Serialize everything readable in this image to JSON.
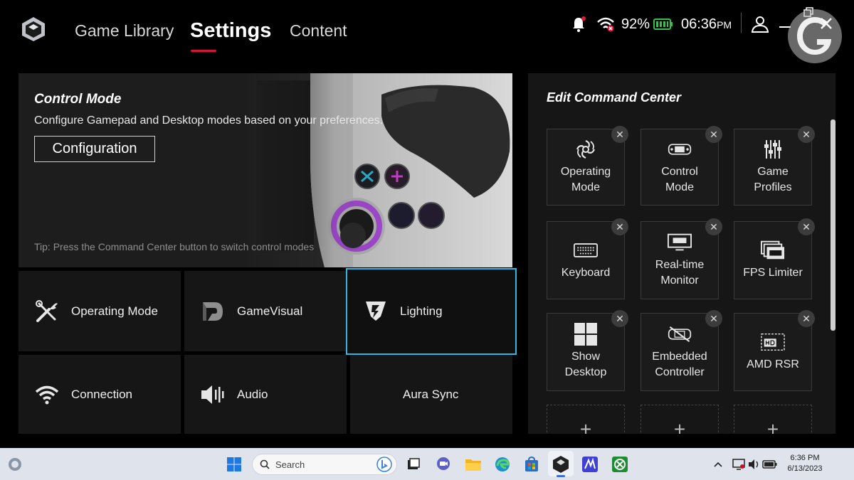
{
  "header": {
    "tabs": [
      {
        "label": "Game Library"
      },
      {
        "label": "Settings",
        "active": true
      },
      {
        "label": "Content"
      }
    ],
    "status": {
      "wifi_percent": "92%",
      "time": "06:36",
      "ampm": "PM"
    }
  },
  "control_mode": {
    "title": "Control Mode",
    "description": "Configure Gamepad and Desktop modes based on your preferences.",
    "button": "Configuration",
    "tip": "Tip: Press the Command Center button to switch control modes"
  },
  "settings_tiles": [
    {
      "label": "Operating Mode",
      "icon": "tools-icon"
    },
    {
      "label": "GameVisual",
      "icon": "gamevisual-icon"
    },
    {
      "label": "Lighting",
      "icon": "lighting-icon",
      "selected": true
    },
    {
      "label": "Connection",
      "icon": "wifi-icon"
    },
    {
      "label": "Audio",
      "icon": "speaker-icon"
    },
    {
      "label": "Aura Sync",
      "icon": ""
    }
  ],
  "command_center": {
    "title": "Edit Command Center",
    "items": [
      {
        "label": "Operating Mode",
        "lines": [
          "Operating",
          "Mode"
        ],
        "icon": "fan-icon"
      },
      {
        "label": "Control Mode",
        "lines": [
          "Control",
          "Mode"
        ],
        "icon": "handheld-icon"
      },
      {
        "label": "Game Profiles",
        "lines": [
          "Game",
          "Profiles"
        ],
        "icon": "sliders-icon"
      },
      {
        "label": "Keyboard",
        "lines": [
          "Keyboard"
        ],
        "icon": "keyboard-icon"
      },
      {
        "label": "Real-time Monitor",
        "lines": [
          "Real-time",
          "Monitor"
        ],
        "icon": "monitor-icon"
      },
      {
        "label": "FPS Limiter",
        "lines": [
          "FPS Limiter"
        ],
        "icon": "fps-icon"
      },
      {
        "label": "Show Desktop",
        "lines": [
          "Show",
          "Desktop"
        ],
        "icon": "windows-icon"
      },
      {
        "label": "Embedded Controller",
        "lines": [
          "Embedded",
          "Controller"
        ],
        "icon": "controller-off-icon"
      },
      {
        "label": "AMD RSR",
        "lines": [
          "AMD RSR"
        ],
        "icon": "hd-icon"
      }
    ],
    "close_glyph": "✕",
    "add_glyph": "+"
  },
  "taskbar": {
    "search_label": "Search",
    "time": "6:36 PM",
    "date": "6/13/2023"
  },
  "colors": {
    "accent_red": "#d5133c",
    "selection_blue": "#2fb6e4",
    "battery_green": "#35c24a"
  }
}
